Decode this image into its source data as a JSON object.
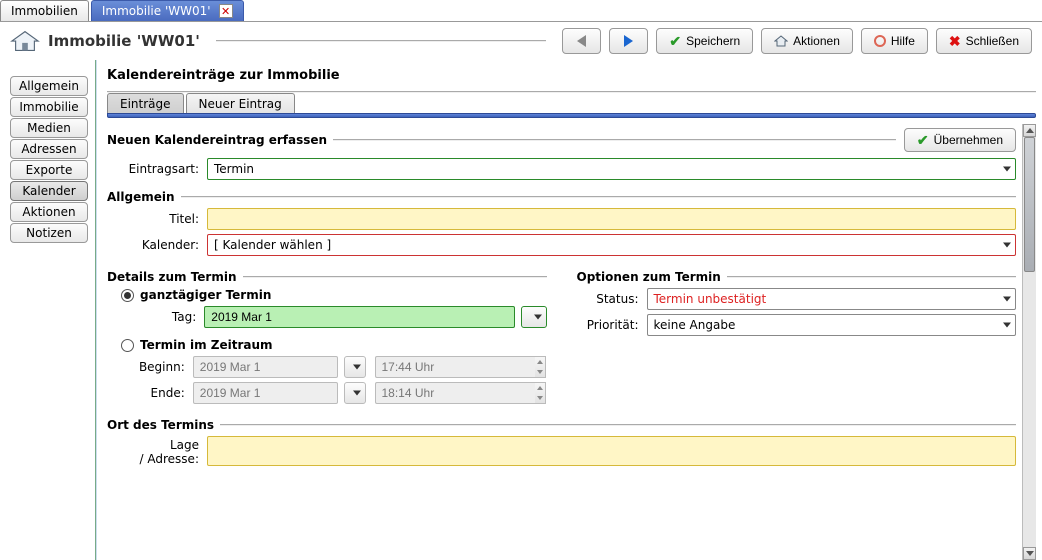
{
  "doc_tabs": {
    "inactive_label": "Immobilien",
    "active_label": "Immobilie 'WW01'"
  },
  "header": {
    "title": "Immobilie 'WW01'",
    "save": "Speichern",
    "actions": "Aktionen",
    "help": "Hilfe",
    "close": "Schließen"
  },
  "sidebar": {
    "items": [
      "Allgemein",
      "Immobilie",
      "Medien",
      "Adressen",
      "Exporte",
      "Kalender",
      "Aktionen",
      "Notizen"
    ],
    "selected_index": 5
  },
  "section_title": "Kalendereinträge zur Immobilie",
  "subtabs_a": "Einträge",
  "subtabs_b": "Neuer Eintrag",
  "form": {
    "head_title": "Neuen Kalendereintrag erfassen",
    "apply_label": "Übernehmen",
    "entry_type_label": "Eintragsart:",
    "entry_type_value": "Termin",
    "group_general": "Allgemein",
    "title_label": "Titel:",
    "title_value": "",
    "calendar_label": "Kalender:",
    "calendar_value": "[ Kalender wählen ]",
    "group_details": "Details zum Termin",
    "radio_allday": "ganztägiger Termin",
    "tag_label": "Tag:",
    "tag_value": "2019 Mar 1",
    "radio_range": "Termin im Zeitraum",
    "begin_label": "Beginn:",
    "begin_date": "2019 Mar 1",
    "begin_time": "17:44 Uhr",
    "end_label": "Ende:",
    "end_date": "2019 Mar 1",
    "end_time": "18:14 Uhr",
    "group_options": "Optionen zum Termin",
    "status_label": "Status:",
    "status_value": "Termin unbestätigt",
    "prio_label": "Priorität:",
    "prio_value": "keine Angabe",
    "group_location": "Ort des Termins",
    "location_label_1": "Lage",
    "location_label_2": "/ Adresse:",
    "location_value": ""
  }
}
